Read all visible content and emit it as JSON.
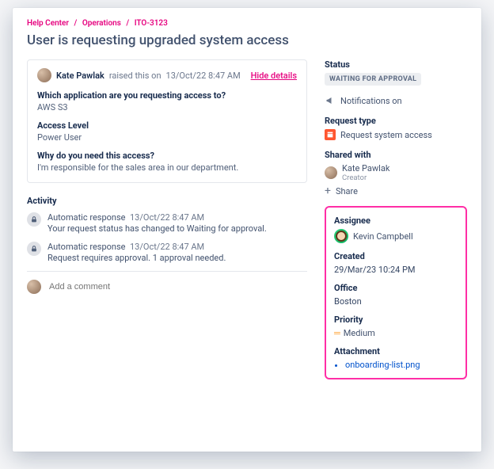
{
  "breadcrumb": {
    "help_center": "Help Center",
    "operations": "Operations",
    "ticket": "ITO-3123"
  },
  "page_title": "User is requesting upgraded system access",
  "request": {
    "requester_name": "Kate Pawlak",
    "raised_text": "raised this on",
    "raised_at": "13/Oct/22 8:47 AM",
    "hide_details": "Hide details",
    "fields": {
      "app_label": "Which application are you requesting access to?",
      "app_value": "AWS S3",
      "level_label": "Access Level",
      "level_value": "Power User",
      "why_label": "Why do you need this access?",
      "why_value": "I'm responsible for the sales area in our department."
    }
  },
  "activity": {
    "title": "Activity",
    "items": [
      {
        "source": "Automatic response",
        "time": "13/Oct/22 8:47 AM",
        "text": "Your request status has changed to Waiting for approval."
      },
      {
        "source": "Automatic response",
        "time": "13/Oct/22 8:47 AM",
        "text": "Request requires approval. 1 approval needed."
      }
    ],
    "comment_placeholder": "Add a comment"
  },
  "sidebar": {
    "status_label": "Status",
    "status_value": "WAITING FOR APPROVAL",
    "notifications": "Notifications on",
    "request_type_label": "Request type",
    "request_type_value": "Request system access",
    "shared_label": "Shared with",
    "shared_name": "Kate Pawlak",
    "shared_role": "Creator",
    "share_action": "Share",
    "assignee_label": "Assignee",
    "assignee_name": "Kevin Campbell",
    "created_label": "Created",
    "created_value": "29/Mar/23 10:24 PM",
    "office_label": "Office",
    "office_value": "Boston",
    "priority_label": "Priority",
    "priority_value": "Medium",
    "attachment_label": "Attachment",
    "attachment_value": "onboarding-list.png"
  }
}
